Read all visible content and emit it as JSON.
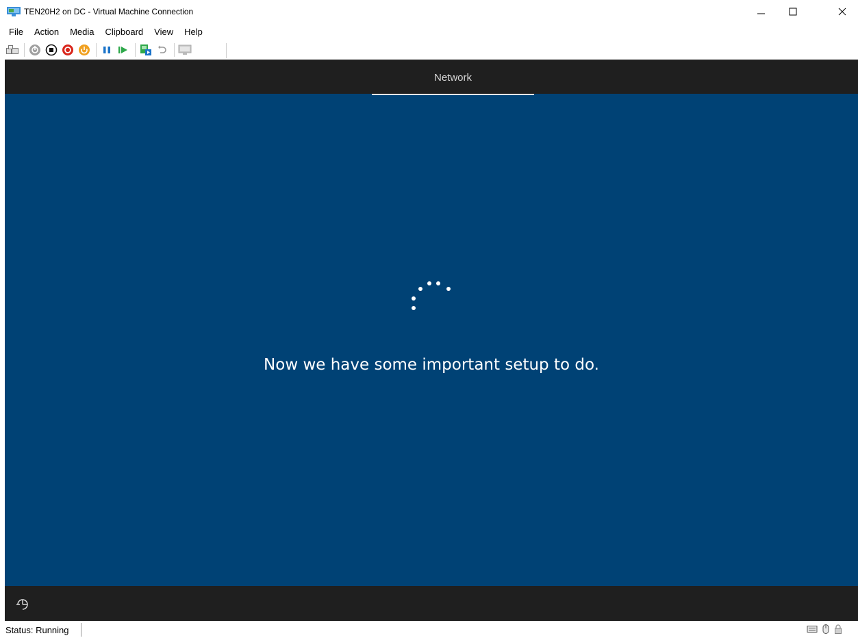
{
  "window": {
    "title": "TEN20H2 on DC - Virtual Machine Connection",
    "controls": [
      "minimize-icon",
      "maximize-icon",
      "close-icon"
    ]
  },
  "menu": {
    "items": [
      "File",
      "Action",
      "Media",
      "Clipboard",
      "View",
      "Help"
    ]
  },
  "toolbar": {
    "buttons": [
      "ctrl-alt-del-icon",
      "start-icon",
      "turn-off-icon",
      "shut-down-icon",
      "save-icon",
      "pause-icon",
      "resume-icon",
      "checkpoint-icon",
      "revert-icon",
      "enhanced-session-icon"
    ],
    "colors": {
      "gray": "#a0a0a0",
      "black": "#111111",
      "red": "#d9261c",
      "orange": "#f0a020",
      "blue": "#1a73c9",
      "green": "#2ea84a"
    }
  },
  "vm": {
    "tab_label": "Network",
    "message": "Now we have some important setup to do.",
    "background": "#004275",
    "bar_color": "#1f1f1f"
  },
  "status": {
    "text": "Status: Running",
    "icons": [
      "keyboard-icon",
      "mouse-icon",
      "lock-icon"
    ]
  }
}
